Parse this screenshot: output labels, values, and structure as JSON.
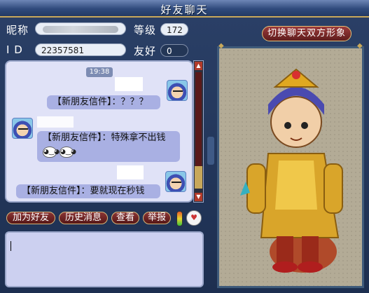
{
  "window": {
    "title": "好友聊天"
  },
  "profile": {
    "nickname_label": "昵称",
    "id_label": "I D",
    "id_value": "22357581",
    "level_label": "等级",
    "level_value": "172",
    "friendship_label": "友好",
    "friendship_value": "0"
  },
  "switch_portrait_button": "切换聊天双方形象",
  "chat": {
    "timestamp": "19:38",
    "messages": [
      {
        "side": "right",
        "text": "【新朋友信件】：？？？"
      },
      {
        "side": "left",
        "text": "【新朋友信件】：特殊拿不出钱"
      },
      {
        "side": "right",
        "text": "【新朋友信件】：要就现在秒钱"
      }
    ],
    "emoji_1": "◕‿◕",
    "emoji_2": "◕‿◕"
  },
  "actions": {
    "add_friend": "加为好友",
    "history": "历史消息",
    "view": "查看",
    "report": "举报"
  },
  "icons": {
    "avatar": "character-avatar-icon",
    "pet": "pet-icon",
    "energy": "energy-gauge-icon"
  },
  "colors": {
    "title_bar": "#2f4a7c",
    "button_red": "#8a3535",
    "chat_background": "#e0e2f7",
    "bubble": "#a9b0e3",
    "gold": "#c8a85a"
  }
}
